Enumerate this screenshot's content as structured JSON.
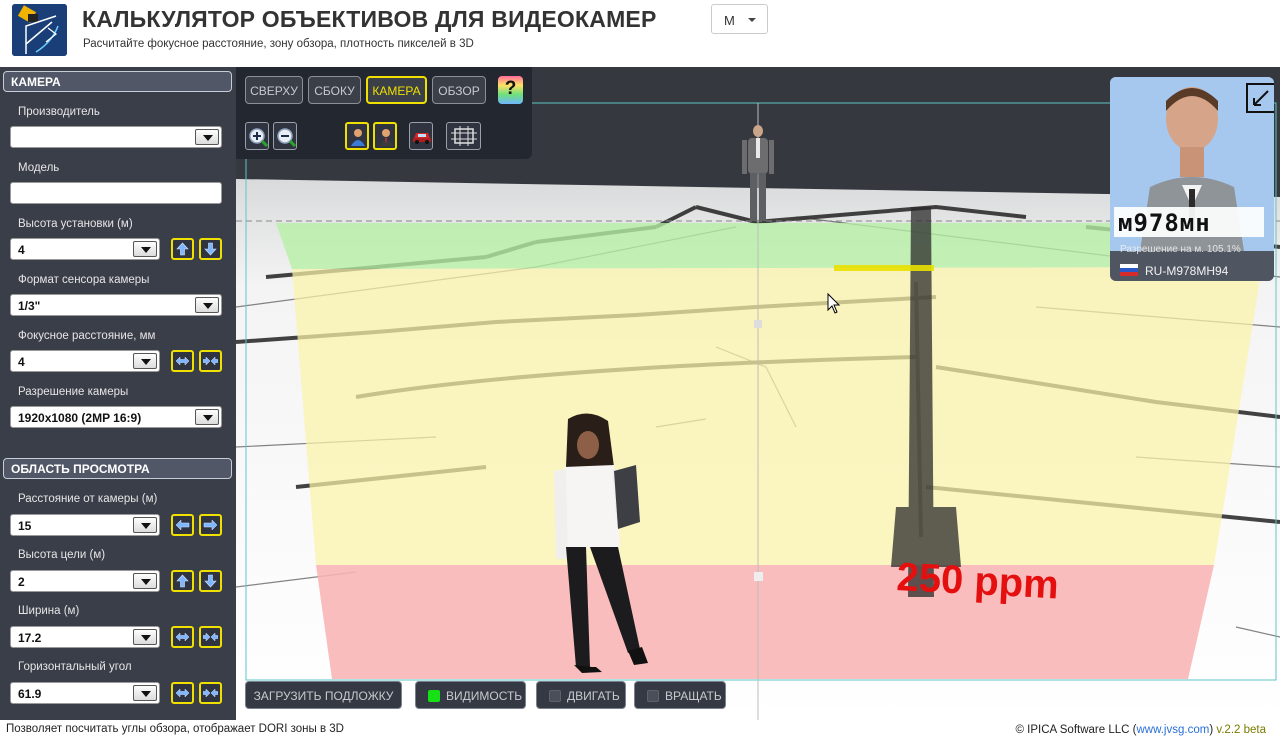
{
  "header": {
    "title": "КАЛЬКУЛЯТОР ОБЪЕКТИВОВ ДЛЯ ВИДЕОКАМЕР",
    "subtitle": "Расчитайте фокусное расстояние, зону обзора, плотность пикселей в 3D",
    "unit_value": "M"
  },
  "sidebar": {
    "camera_section": "КАМЕРА",
    "manufacturer_label": "Производитель",
    "manufacturer_value": "",
    "model_label": "Модель",
    "model_value": "",
    "height_label": "Высота установки (м)",
    "height_value": "4",
    "sensor_label": "Формат сенсора камеры",
    "sensor_value": "1/3\"",
    "focal_label": "Фокусное расстояние, мм",
    "focal_value": "4",
    "resolution_label": "Разрешение камеры",
    "resolution_value": "1920x1080 (2MP 16:9)",
    "view_section": "ОБЛАСТЬ ПРОСМОТРА",
    "distance_label": "Расстояние от камеры (м)",
    "distance_value": "15",
    "target_height_label": "Высота цели (м)",
    "target_height_value": "2",
    "width_label": "Ширина (м)",
    "width_value": "17.2",
    "hangle_label": "Горизонтальный угол",
    "hangle_value": "61.9"
  },
  "viewport": {
    "tabs": [
      "СВЕРХУ",
      "СБОКУ",
      "КАМЕРА",
      "ОБЗОР"
    ],
    "active_tab": "КАМЕРА",
    "help_label": "?",
    "ppm_label": "250 ppm",
    "preview": {
      "plate_text": "RU-M978MH94",
      "plate_overlay": "м978мн",
      "scale_text": "Разрешение на м.  105.1%"
    },
    "bottom_buttons": {
      "load_background": "ЗАГРУЗИТЬ ПОДЛОЖКУ",
      "visibility": "ВИДИМОСТЬ",
      "move": "ДВИГАТЬ",
      "rotate": "ВРАЩАТЬ"
    },
    "visibility_on": true,
    "colors": {
      "zone_green": "#b5f0a4",
      "zone_yellow": "#fbf3a9",
      "zone_red": "#f9b4b4",
      "accent": "#f0e000"
    }
  },
  "status": {
    "left": "Позволяет посчитать углы обзора, отображает DORI зоны в 3D",
    "copyright": "© IPICA Software LLC (",
    "site": "www.jvsg.com",
    "close_paren": ") ",
    "version": "v.2.2 beta"
  }
}
